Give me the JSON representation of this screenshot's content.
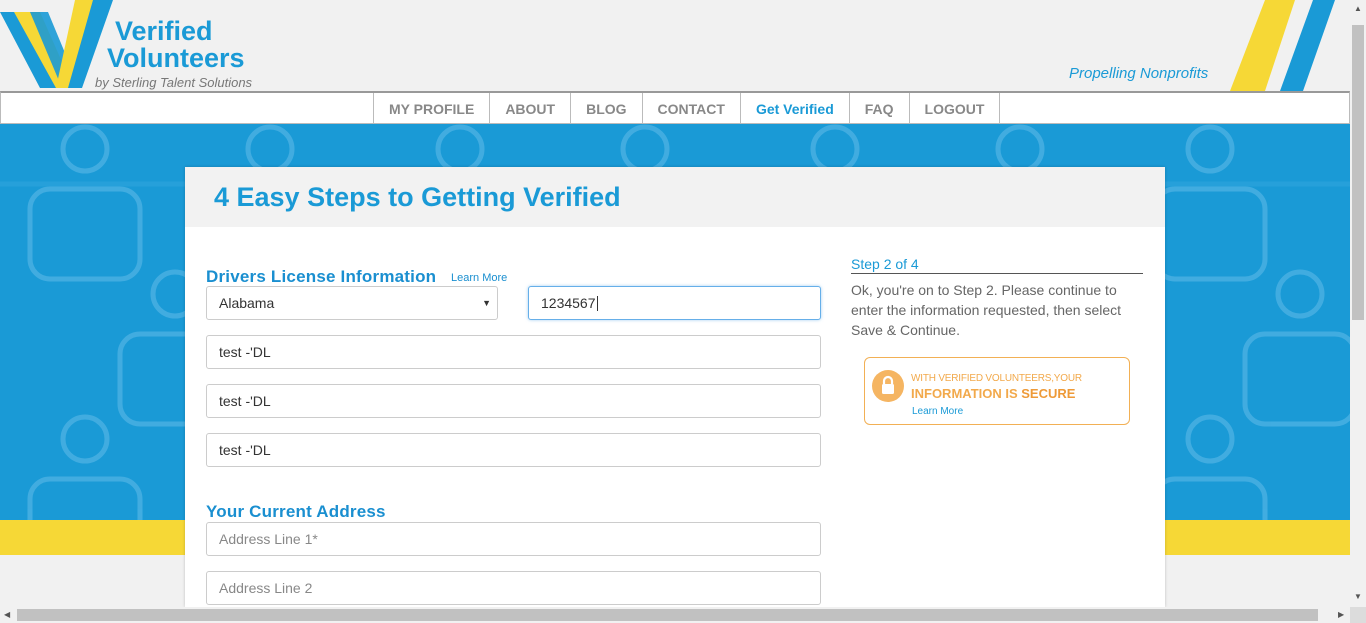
{
  "brand": {
    "name_line1": "Verified",
    "name_line2": "Volunteers",
    "sub": "by Sterling Talent Solutions",
    "tagline": "Propelling Nonprofits",
    "colors": {
      "blue": "#1a9ad6",
      "yellow": "#f6d836",
      "orange": "#f2a94b"
    }
  },
  "nav": {
    "items": [
      {
        "label": "MY PROFILE"
      },
      {
        "label": "ABOUT"
      },
      {
        "label": "BLOG"
      },
      {
        "label": "CONTACT"
      },
      {
        "label": "Get Verified",
        "active": true
      },
      {
        "label": "FAQ"
      },
      {
        "label": "LOGOUT"
      }
    ]
  },
  "card": {
    "title": "4 Easy Steps to Getting Verified",
    "drivers_license": {
      "heading": "Drivers License Information",
      "learn_more": "Learn More",
      "state_select": "Alabama",
      "license_number": "1234567",
      "field1": "test -'DL",
      "field2": "test -'DL",
      "field3": "test -'DL"
    },
    "address": {
      "heading": "Your Current Address",
      "line1_placeholder": "Address Line 1*",
      "line2_placeholder": "Address Line 2"
    }
  },
  "sidebar": {
    "step_title": "Step 2 of 4",
    "step_text": "Ok, you're on to Step 2. Please continue to enter the information requested, then select Save & Continue.",
    "badge": {
      "line1": "WITH VERIFIED VOLUNTEERS,YOUR",
      "line2_prefix": "INFORMATION IS ",
      "line2_emphasis": "SECURE",
      "link": "Learn More",
      "icon": "lock-icon"
    }
  },
  "scrollbars": {
    "up": "▲",
    "down": "▼",
    "left": "◀",
    "right": "▶"
  }
}
